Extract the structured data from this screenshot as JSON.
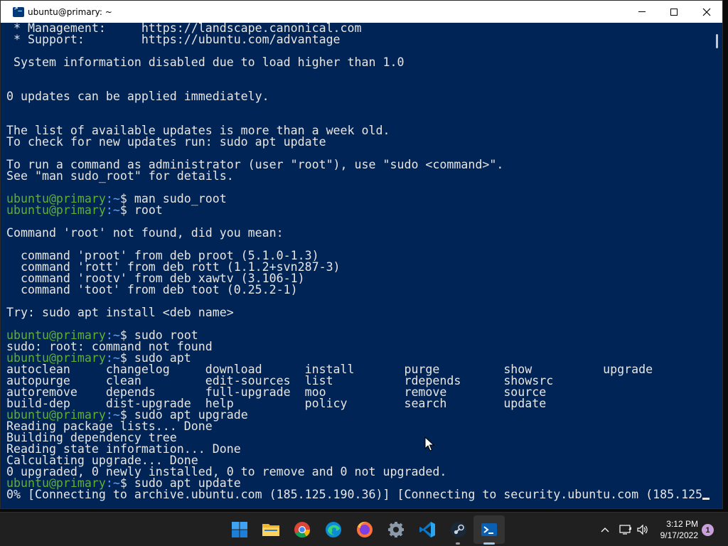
{
  "window": {
    "title": "ubuntu@primary: ~"
  },
  "terminal": {
    "prompt_user": "ubuntu@primary",
    "prompt_path": ":~",
    "lines": [
      {
        "type": "text",
        "text": " * Management:     https://landscape.canonical.com"
      },
      {
        "type": "text",
        "text": " * Support:        https://ubuntu.com/advantage"
      },
      {
        "type": "text",
        "text": ""
      },
      {
        "type": "text",
        "text": " System information disabled due to load higher than 1.0"
      },
      {
        "type": "text",
        "text": ""
      },
      {
        "type": "text",
        "text": ""
      },
      {
        "type": "text",
        "text": "0 updates can be applied immediately."
      },
      {
        "type": "text",
        "text": ""
      },
      {
        "type": "text",
        "text": ""
      },
      {
        "type": "text",
        "text": "The list of available updates is more than a week old."
      },
      {
        "type": "text",
        "text": "To check for new updates run: sudo apt update"
      },
      {
        "type": "text",
        "text": ""
      },
      {
        "type": "text",
        "text": "To run a command as administrator (user \"root\"), use \"sudo <command>\"."
      },
      {
        "type": "text",
        "text": "See \"man sudo_root\" for details."
      },
      {
        "type": "text",
        "text": ""
      },
      {
        "type": "prompt",
        "text": "$ man sudo_root"
      },
      {
        "type": "prompt",
        "text": "$ root"
      },
      {
        "type": "text",
        "text": ""
      },
      {
        "type": "text",
        "text": "Command 'root' not found, did you mean:"
      },
      {
        "type": "text",
        "text": ""
      },
      {
        "type": "text",
        "text": "  command 'proot' from deb proot (5.1.0-1.3)"
      },
      {
        "type": "text",
        "text": "  command 'rott' from deb rott (1.1.2+svn287-3)"
      },
      {
        "type": "text",
        "text": "  command 'rootv' from deb xawtv (3.106-1)"
      },
      {
        "type": "text",
        "text": "  command 'toot' from deb toot (0.25.2-1)"
      },
      {
        "type": "text",
        "text": ""
      },
      {
        "type": "text",
        "text": "Try: sudo apt install <deb name>"
      },
      {
        "type": "text",
        "text": ""
      },
      {
        "type": "prompt",
        "text": "$ sudo root"
      },
      {
        "type": "text",
        "text": "sudo: root: command not found"
      },
      {
        "type": "prompt",
        "text": "$ sudo apt"
      },
      {
        "type": "text",
        "text": "autoclean     changelog     download      install       purge         show          upgrade"
      },
      {
        "type": "text",
        "text": "autopurge     clean         edit-sources  list          rdepends      showsrc"
      },
      {
        "type": "text",
        "text": "autoremove    depends       full-upgrade  moo           remove        source"
      },
      {
        "type": "text",
        "text": "build-dep     dist-upgrade  help          policy        search        update"
      },
      {
        "type": "prompt",
        "text": "$ sudo apt upgrade"
      },
      {
        "type": "text",
        "text": "Reading package lists... Done"
      },
      {
        "type": "text",
        "text": "Building dependency tree"
      },
      {
        "type": "text",
        "text": "Reading state information... Done"
      },
      {
        "type": "text",
        "text": "Calculating upgrade... Done"
      },
      {
        "type": "text",
        "text": "0 upgraded, 0 newly installed, 0 to remove and 0 not upgraded."
      },
      {
        "type": "prompt",
        "text": "$ sudo apt update"
      },
      {
        "type": "cursorline",
        "text": "0% [Connecting to archive.ubuntu.com (185.125.190.36)] [Connecting to security.ubuntu.com (185.125"
      }
    ]
  },
  "taskbar": {
    "apps": [
      "start-icon",
      "file-explorer-icon",
      "chrome-icon",
      "edge-icon",
      "firefox-icon",
      "settings-icon",
      "vscode-icon",
      "steam-icon",
      "terminal-icon"
    ],
    "clock_time": "3:12 PM",
    "clock_date": "9/17/2022",
    "notification_count": "1"
  },
  "colors": {
    "terminal_bg": "#012456",
    "prompt_user": "#5faf3a",
    "prompt_path": "#5fa8ff",
    "taskbar_bg": "#202020"
  }
}
